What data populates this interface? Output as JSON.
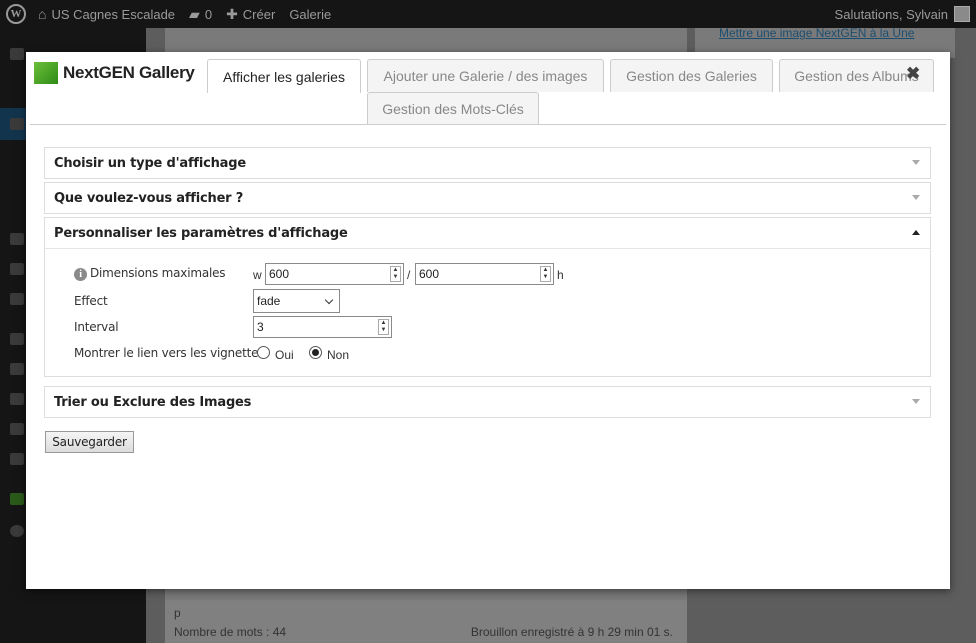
{
  "adminbar": {
    "site_name": "US Cagnes Escalade",
    "comments_count": "0",
    "create_label": "Créer",
    "gallery_label": "Galerie",
    "greeting": "Salutations, Sylvain"
  },
  "background": {
    "sidebar_link": "Mettre une image NextGEN à la Une",
    "status_p": "p",
    "word_count": "Nombre de mots : 44",
    "draft_saved": "Brouillon enregistré à 9 h 29 min 01 s."
  },
  "modal": {
    "logo_text": "NextGEN Gallery",
    "close_glyph": "✖",
    "tabs": [
      {
        "label": "Afficher les galeries"
      },
      {
        "label": "Ajouter une Galerie / des images"
      },
      {
        "label": "Gestion des Galeries"
      },
      {
        "label": "Gestion des Albums"
      },
      {
        "label": "Gestion des Mots-Clés"
      }
    ],
    "sections": {
      "display_type": "Choisir un type d'affichage",
      "what_to_show": "Que voulez-vous afficher ?",
      "customize": "Personnaliser les paramètres d'affichage",
      "sort_exclude": "Trier ou Exclure des Images"
    },
    "settings": {
      "max_dimensions_label": "Dimensions maximales",
      "width_prefix": "w",
      "width_value": "600",
      "separator": "/",
      "height_value": "600",
      "height_suffix": "h",
      "effect_label": "Effect",
      "effect_value": "fade",
      "interval_label": "Interval",
      "interval_value": "3",
      "thumbnail_link_label": "Montrer le lien vers les vignettes",
      "option_yes": "Oui",
      "option_no": "Non",
      "selected_option": "Non"
    },
    "save_label": "Sauvegarder"
  }
}
